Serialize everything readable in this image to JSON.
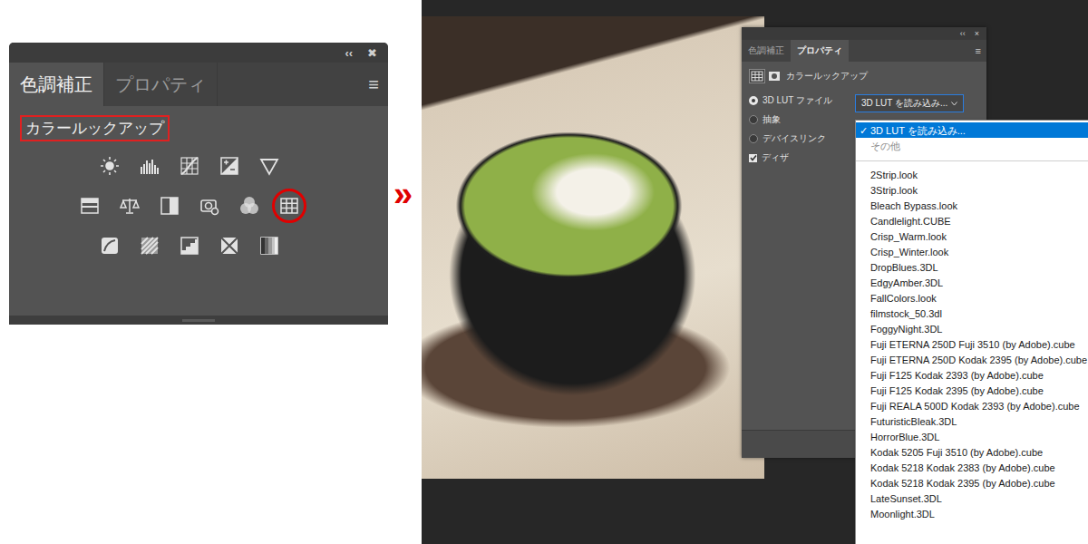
{
  "left_panel": {
    "header_icons": [
      "‹‹",
      "✖"
    ],
    "tabs": [
      {
        "label": "色調補正",
        "selected": true
      },
      {
        "label": "プロパティ",
        "selected": false
      }
    ],
    "menu_icon": "≡",
    "section_label": "カラールックアップ",
    "icon_rows": [
      [
        {
          "kind": "brightness",
          "circled": false
        },
        {
          "kind": "levels",
          "circled": false
        },
        {
          "kind": "curves",
          "circled": false
        },
        {
          "kind": "exposure",
          "circled": false
        },
        {
          "kind": "vibrance",
          "circled": false
        }
      ],
      [
        {
          "kind": "hue",
          "circled": false
        },
        {
          "kind": "balance",
          "circled": false
        },
        {
          "kind": "bw",
          "circled": false
        },
        {
          "kind": "photo-filter",
          "circled": false
        },
        {
          "kind": "channel-mixer",
          "circled": false
        },
        {
          "kind": "color-lookup",
          "circled": true
        }
      ],
      [
        {
          "kind": "invert",
          "circled": false
        },
        {
          "kind": "posterize",
          "circled": false
        },
        {
          "kind": "threshold",
          "circled": false
        },
        {
          "kind": "selective-color",
          "circled": false
        },
        {
          "kind": "gradient-map",
          "circled": false
        }
      ]
    ]
  },
  "arrow": "»",
  "properties_panel": {
    "header_icons": [
      "‹‹",
      "×"
    ],
    "tabs": [
      {
        "label": "色調補正",
        "selected": false
      },
      {
        "label": "プロパティ",
        "selected": true
      }
    ],
    "menu_icon": "≡",
    "title": "カラールックアップ",
    "options": [
      {
        "label": "3D LUT ファイル",
        "kind": "radio",
        "selected": true
      },
      {
        "label": "抽象",
        "kind": "radio",
        "selected": false
      },
      {
        "label": "デバイスリンク",
        "kind": "radio",
        "selected": false
      },
      {
        "label": "ディザ",
        "kind": "checkbox",
        "checked": true
      }
    ],
    "dropdown": {
      "value": "3D LUT を読み込み...",
      "open": true
    }
  },
  "menu": {
    "check_mark": "✓",
    "top_items": [
      {
        "label": "3D LUT を読み込み...",
        "selected": true,
        "disabled": false
      },
      {
        "label": "その他",
        "selected": false,
        "disabled": true
      }
    ],
    "items": [
      {
        "label": "2Strip.look",
        "selected": false,
        "disabled": false
      },
      {
        "label": "3Strip.look",
        "selected": false,
        "disabled": false
      },
      {
        "label": "Bleach Bypass.look",
        "selected": false,
        "disabled": false
      },
      {
        "label": "Candlelight.CUBE",
        "selected": false,
        "disabled": false
      },
      {
        "label": "Crisp_Warm.look",
        "selected": false,
        "disabled": false
      },
      {
        "label": "Crisp_Winter.look",
        "selected": false,
        "disabled": false
      },
      {
        "label": "DropBlues.3DL",
        "selected": false,
        "disabled": false
      },
      {
        "label": "EdgyAmber.3DL",
        "selected": false,
        "disabled": false
      },
      {
        "label": "FallColors.look",
        "selected": false,
        "disabled": false
      },
      {
        "label": "filmstock_50.3dl",
        "selected": false,
        "disabled": false
      },
      {
        "label": "FoggyNight.3DL",
        "selected": false,
        "disabled": false
      },
      {
        "label": "Fuji ETERNA 250D Fuji 3510 (by Adobe).cube",
        "selected": false,
        "disabled": false
      },
      {
        "label": "Fuji ETERNA 250D Kodak 2395 (by Adobe).cube",
        "selected": false,
        "disabled": false
      },
      {
        "label": "Fuji F125 Kodak 2393 (by Adobe).cube",
        "selected": false,
        "disabled": false
      },
      {
        "label": "Fuji F125 Kodak 2395 (by Adobe).cube",
        "selected": false,
        "disabled": false
      },
      {
        "label": "Fuji REALA 500D Kodak 2393 (by Adobe).cube",
        "selected": false,
        "disabled": false
      },
      {
        "label": "FuturisticBleak.3DL",
        "selected": false,
        "disabled": false
      },
      {
        "label": "HorrorBlue.3DL",
        "selected": false,
        "disabled": false
      },
      {
        "label": "Kodak 5205 Fuji 3510 (by Adobe).cube",
        "selected": false,
        "disabled": false
      },
      {
        "label": "Kodak 5218 Kodak 2383 (by Adobe).cube",
        "selected": false,
        "disabled": false
      },
      {
        "label": "Kodak 5218 Kodak 2395 (by Adobe).cube",
        "selected": false,
        "disabled": false
      },
      {
        "label": "LateSunset.3DL",
        "selected": false,
        "disabled": false
      },
      {
        "label": "Moonlight.3DL",
        "selected": false,
        "disabled": false
      }
    ]
  }
}
